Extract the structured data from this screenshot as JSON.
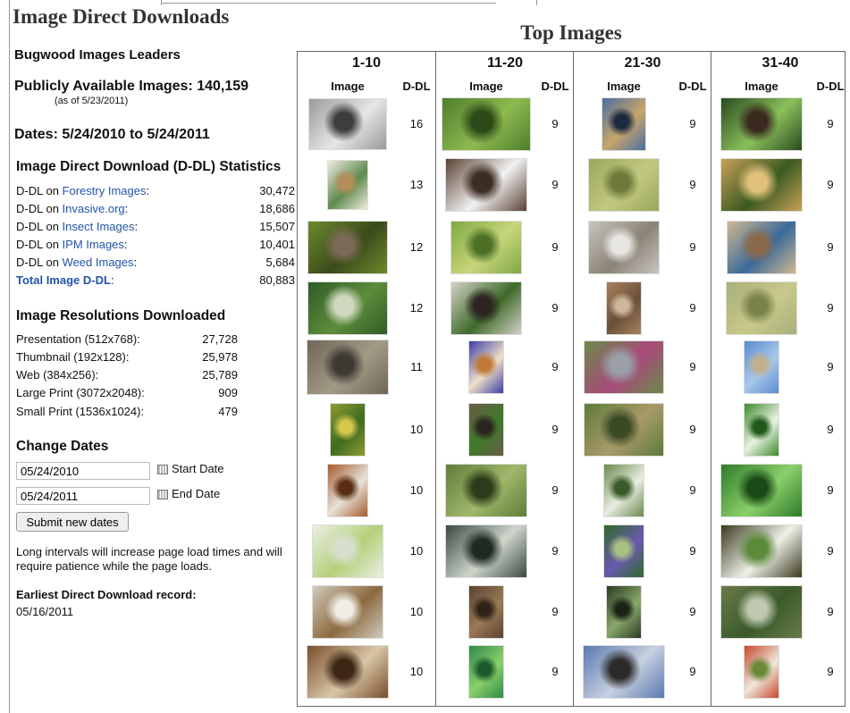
{
  "page_title": "Image Direct Downloads",
  "leaders_heading": "Bugwood Images Leaders",
  "public_images": {
    "label": "Publicly Available Images: 140,159",
    "as_of": "(as of 5/23/2011)"
  },
  "dates_line": "Dates: 5/24/2010 to 5/24/2011",
  "ddl_stats": {
    "heading": "Image Direct Download (D-DL) Statistics",
    "rows": [
      {
        "prefix": "D-DL on ",
        "link": "Forestry Images",
        "suffix": ":",
        "value": "30,472"
      },
      {
        "prefix": "D-DL on ",
        "link": "Invasive.org",
        "suffix": ":",
        "value": "18,686"
      },
      {
        "prefix": "D-DL on ",
        "link": "Insect Images",
        "suffix": ":",
        "value": "15,507"
      },
      {
        "prefix": "D-DL on ",
        "link": "IPM Images",
        "suffix": ":",
        "value": "10,401"
      },
      {
        "prefix": "D-DL on ",
        "link": "Weed Images",
        "suffix": ":",
        "value": "5,684"
      }
    ],
    "total": {
      "label": "Total Image D-DL",
      "suffix": ":",
      "value": "80,883"
    }
  },
  "resolutions": {
    "heading": "Image Resolutions Downloaded",
    "rows": [
      {
        "label": "Presentation (512x768):",
        "value": "27,728"
      },
      {
        "label": "Thumbnail (192x128):",
        "value": "25,978"
      },
      {
        "label": "Web (384x256):",
        "value": "25,789"
      },
      {
        "label": "Large Print (3072x2048):",
        "value": "909"
      },
      {
        "label": "Small Print (1536x1024):",
        "value": "479"
      }
    ]
  },
  "change_dates": {
    "heading": "Change Dates",
    "start_value": "05/24/2010",
    "start_label": "Start Date",
    "end_value": "05/24/2011",
    "end_label": "End Date",
    "submit_label": "Submit new dates",
    "note": "Long intervals will increase page load times and will require patience while the page loads."
  },
  "earliest": {
    "label": "Earliest Direct Download record:",
    "value": "05/16/2011"
  },
  "top_images": {
    "title": "Top Images",
    "image_header": "Image",
    "ddl_header": "D-DL",
    "columns": [
      {
        "label": "1-10",
        "ddl": [
          "16",
          "13",
          "12",
          "12",
          "11",
          "10",
          "10",
          "10",
          "10",
          "10"
        ],
        "thumbs": [
          {
            "subject": "insects on leaf",
            "colors": [
              "#9a9a9a",
              "#e6e6e6",
              "#3d3d3d"
            ]
          },
          {
            "subject": "pine cone illustration",
            "colors": [
              "#f0ece0",
              "#5f8a4e",
              "#b48d5a"
            ]
          },
          {
            "subject": "stink bug",
            "colors": [
              "#6d8a2c",
              "#3a4a1a",
              "#7b6a55"
            ]
          },
          {
            "subject": "forest edge",
            "colors": [
              "#2f5c26",
              "#5e8c3a",
              "#cfd9c0"
            ]
          },
          {
            "subject": "dry brush",
            "colors": [
              "#6e6657",
              "#a39a86",
              "#3e3a33"
            ]
          },
          {
            "subject": "yellow flowers",
            "colors": [
              "#8f9a33",
              "#3e6b1f",
              "#d6c84a"
            ]
          },
          {
            "subject": "beetle",
            "colors": [
              "#a65a2c",
              "#e7e3d9",
              "#5a2d14"
            ]
          },
          {
            "subject": "green insect",
            "colors": [
              "#eaf0e3",
              "#b5cf7a",
              "#d8dfcc"
            ]
          },
          {
            "subject": "moth",
            "colors": [
              "#cfcabd",
              "#8c6a3f",
              "#f0ede6"
            ]
          },
          {
            "subject": "larva",
            "colors": [
              "#7a4e2a",
              "#d8c7a8",
              "#3d2614"
            ]
          }
        ]
      },
      {
        "label": "11-20",
        "ddl": [
          "9",
          "9",
          "9",
          "9",
          "9",
          "9",
          "9",
          "9",
          "9",
          "9"
        ],
        "thumbs": [
          {
            "subject": "green leaves",
            "colors": [
              "#4f7d2c",
              "#8dba4f",
              "#2c4a18"
            ]
          },
          {
            "subject": "white flower",
            "colors": [
              "#5a4133",
              "#f2f2f2",
              "#3c2c22"
            ]
          },
          {
            "subject": "green larva on leaf",
            "colors": [
              "#7fa844",
              "#c7d67a",
              "#4d7027"
            ]
          },
          {
            "subject": "berries and leaves",
            "colors": [
              "#d4d2c8",
              "#3f6a2a",
              "#2b2422"
            ]
          },
          {
            "subject": "damaged leaf",
            "colors": [
              "#3c3fa8",
              "#f0e0c8",
              "#c0793a"
            ]
          },
          {
            "subject": "tree bark",
            "colors": [
              "#6a5a48",
              "#3f7a2a",
              "#2a241f"
            ]
          },
          {
            "subject": "insect on branch",
            "colors": [
              "#5f7d3a",
              "#9fb86a",
              "#2d3b1a"
            ]
          },
          {
            "subject": "fern frond",
            "colors": [
              "#3a4a40",
              "#cfd6cc",
              "#1f2a22"
            ]
          },
          {
            "subject": "bark with hole",
            "colors": [
              "#5a4330",
              "#9a7a55",
              "#2e2218"
            ]
          },
          {
            "subject": "green shoot",
            "colors": [
              "#2f8a4a",
              "#8ad06a",
              "#1c5a2c"
            ]
          }
        ]
      },
      {
        "label": "21-30",
        "ddl": [
          "9",
          "9",
          "9",
          "9",
          "9",
          "9",
          "9",
          "9",
          "9",
          "9"
        ],
        "thumbs": [
          {
            "subject": "weevil",
            "colors": [
              "#4a6fa0",
              "#c8a56a",
              "#1c2a40"
            ]
          },
          {
            "subject": "leaf surface",
            "colors": [
              "#9aa85a",
              "#c2c880",
              "#6e7a3a"
            ]
          },
          {
            "subject": "field",
            "colors": [
              "#c9c4bd",
              "#8a8377",
              "#e8e6e1"
            ]
          },
          {
            "subject": "weed plant",
            "colors": [
              "#a8825c",
              "#6a4f3a",
              "#cdb69a"
            ]
          },
          {
            "subject": "flower cluster",
            "colors": [
              "#6a8a4a",
              "#a84a7a",
              "#9aa0a8"
            ]
          },
          {
            "subject": "meadow",
            "colors": [
              "#5f7a3a",
              "#a89a6a",
              "#3a4a24"
            ]
          },
          {
            "subject": "shrub",
            "colors": [
              "#6a8a4a",
              "#e8ede2",
              "#3a5a28"
            ]
          },
          {
            "subject": "purple flowers",
            "colors": [
              "#2f6a2a",
              "#6a5ab0",
              "#a8c080"
            ]
          },
          {
            "subject": "leafy plant",
            "colors": [
              "#2a3a22",
              "#8aa86a",
              "#1a2416"
            ]
          },
          {
            "subject": "fly",
            "colors": [
              "#5a7ab0",
              "#c8d0e0",
              "#2a2a2a"
            ]
          }
        ]
      },
      {
        "label": "31-40",
        "ddl": [
          "9",
          "9",
          "9",
          "9",
          "9",
          "9",
          "9",
          "9",
          "9",
          "9"
        ],
        "thumbs": [
          {
            "subject": "seedling leaves",
            "colors": [
              "#2a4a20",
              "#8ac05a",
              "#3a2a1f"
            ]
          },
          {
            "subject": "vine on soil",
            "colors": [
              "#c8a058",
              "#3a5a20",
              "#e0c07a"
            ]
          },
          {
            "subject": "caterpillar",
            "colors": [
              "#d0b890",
              "#3a6a9a",
              "#8a6a4a"
            ]
          },
          {
            "subject": "pale insect",
            "colors": [
              "#a8b07a",
              "#c8c88a",
              "#7a844a"
            ]
          },
          {
            "subject": "grass seedhead",
            "colors": [
              "#5a8ad0",
              "#a8c8ea",
              "#c0b090"
            ]
          },
          {
            "subject": "green weed",
            "colors": [
              "#3a8a2a",
              "#eaf2e2",
              "#1f5a18"
            ]
          },
          {
            "subject": "leafy canopy",
            "colors": [
              "#2f7a2a",
              "#8ad06a",
              "#1a4a16"
            ]
          },
          {
            "subject": "seedling with label",
            "colors": [
              "#3a3a1f",
              "#f0f0e8",
              "#5a8a3a"
            ]
          },
          {
            "subject": "rosette weed",
            "colors": [
              "#6a7a4a",
              "#3a5a2a",
              "#c0c8b0"
            ]
          },
          {
            "subject": "red flower",
            "colors": [
              "#c8462a",
              "#eee8dc",
              "#6a8a3a"
            ]
          }
        ]
      }
    ]
  }
}
